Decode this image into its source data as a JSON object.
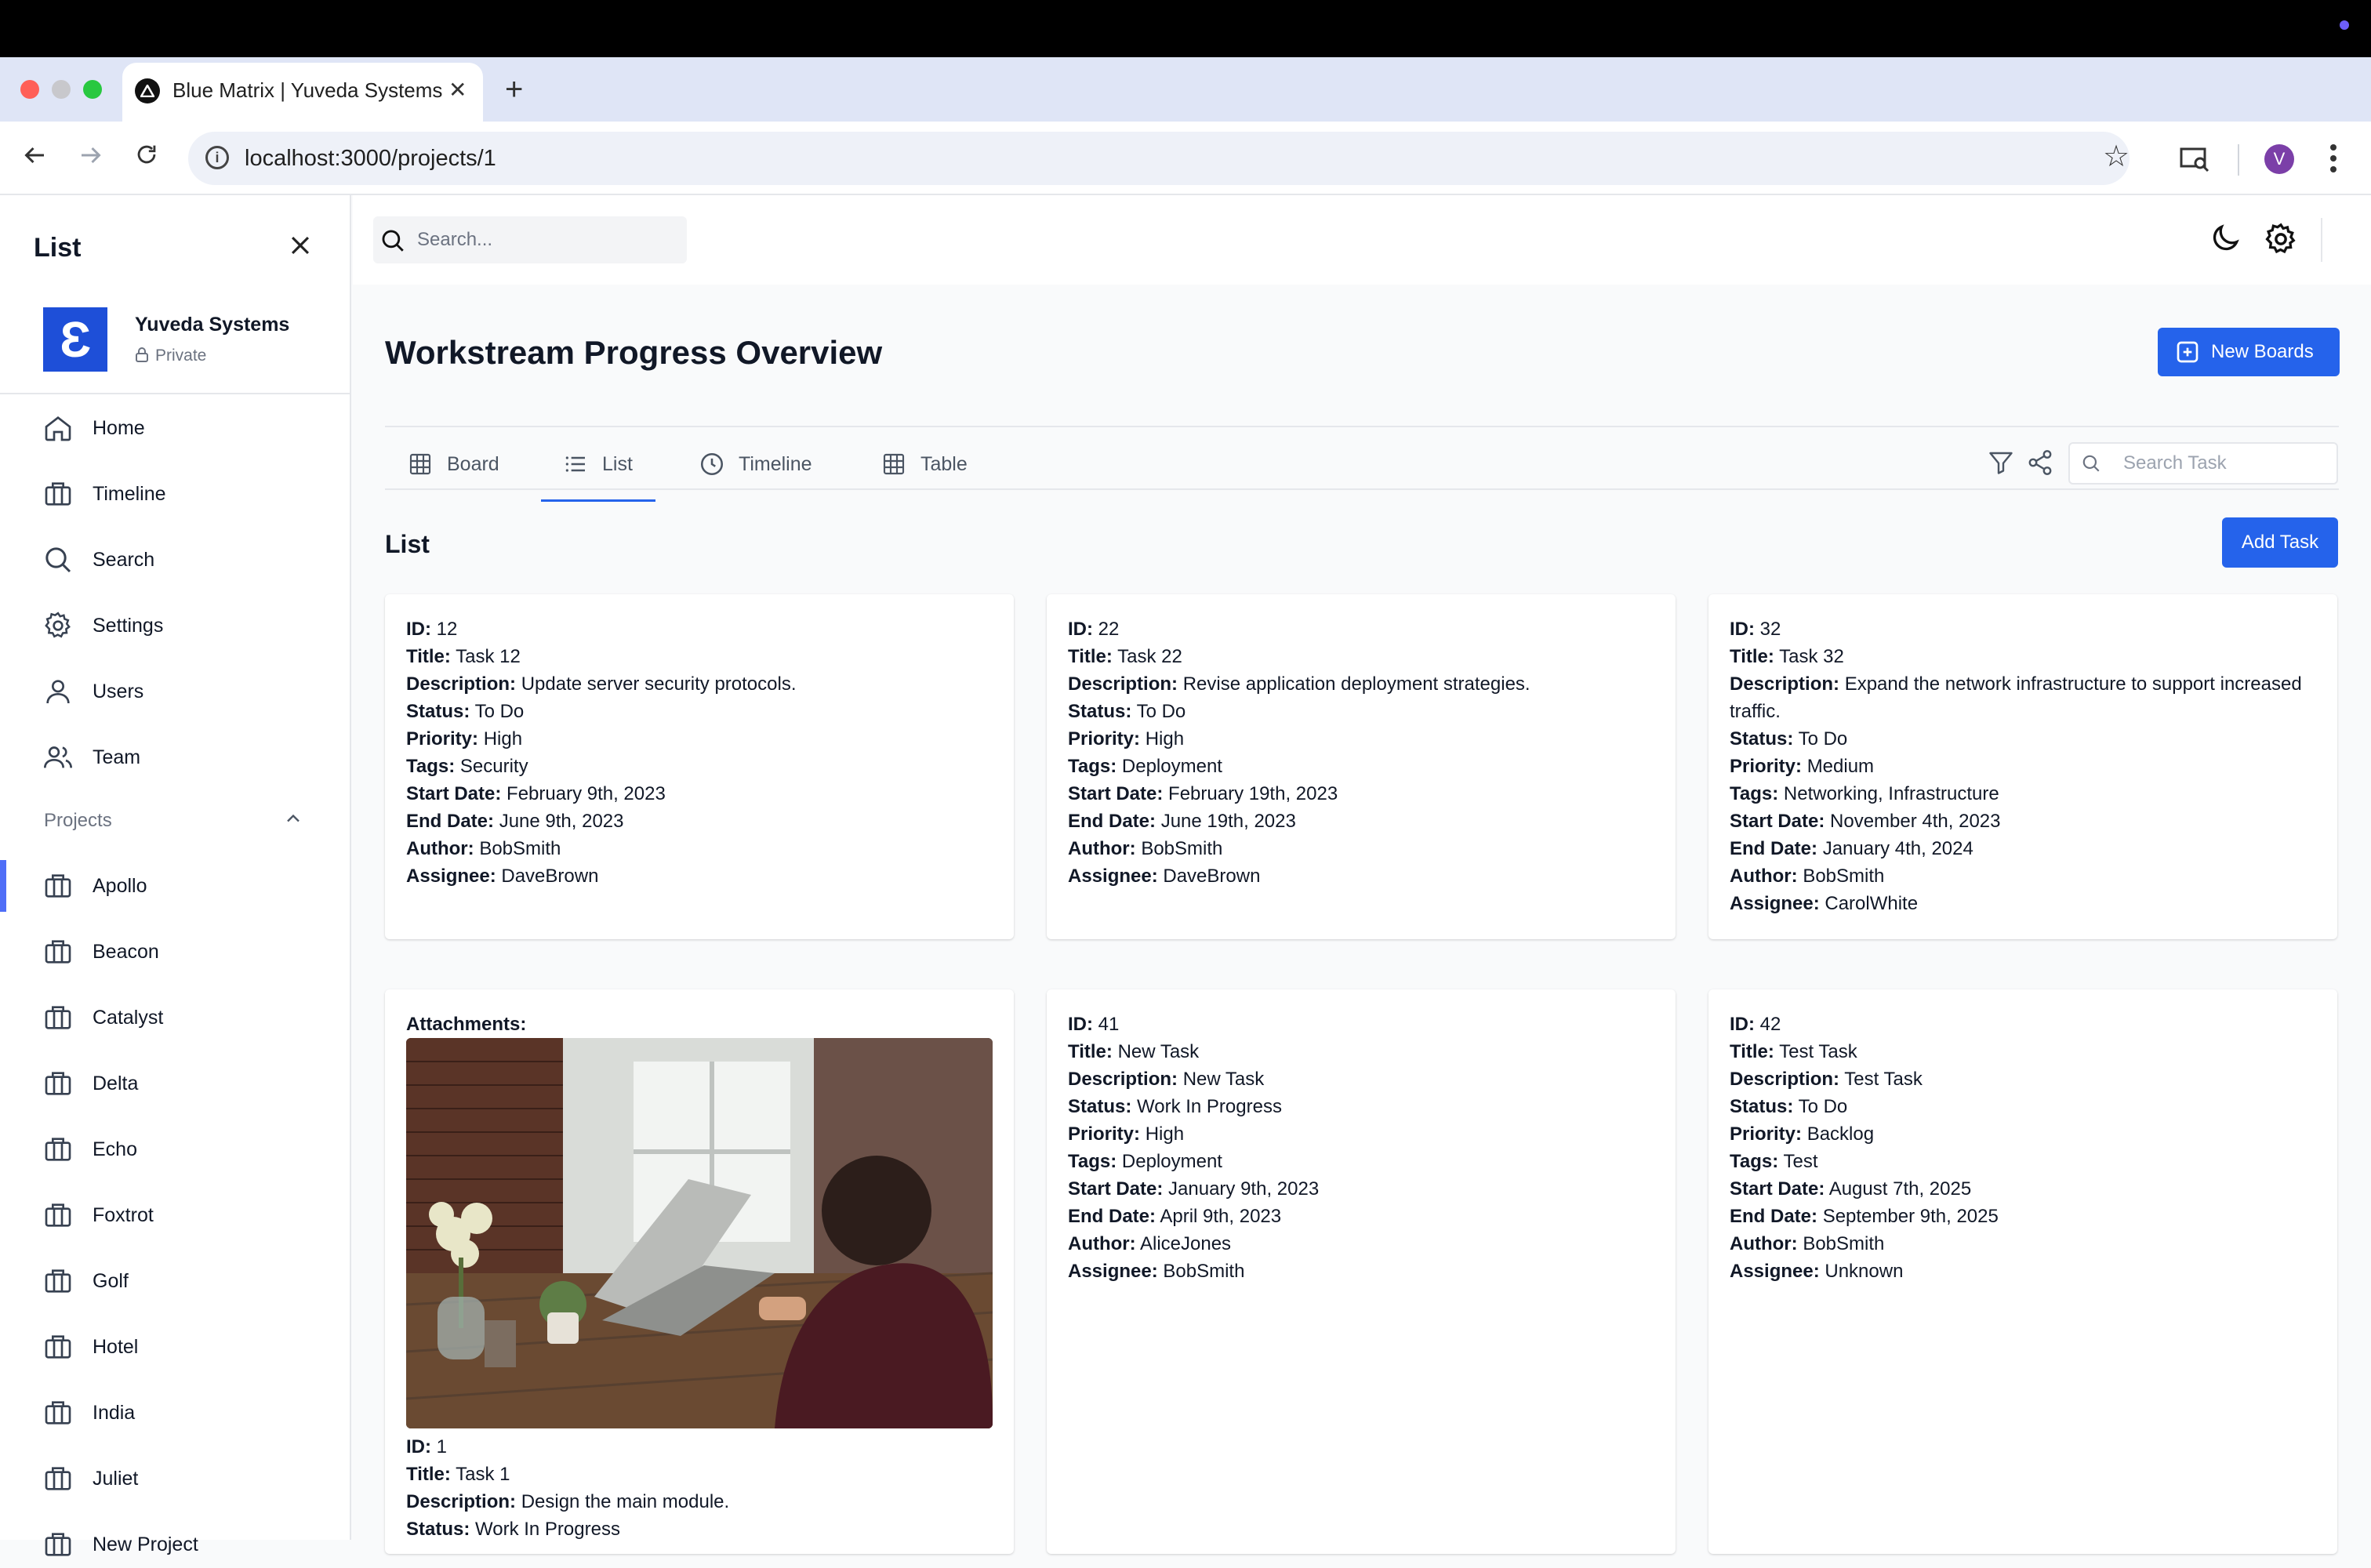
{
  "browser": {
    "tab_title": "Blue Matrix | Yuveda Systems",
    "tab_close": "✕",
    "new_tab": "+",
    "url": "localhost:3000/projects/1",
    "profile_initial": "V"
  },
  "sidebar": {
    "title": "List",
    "workspace": {
      "logo_letter": "Ɛ",
      "name": "Yuveda Systems",
      "privacy": "Private"
    },
    "nav": [
      {
        "label": "Home",
        "icon": "home-icon"
      },
      {
        "label": "Timeline",
        "icon": "briefcase-icon"
      },
      {
        "label": "Search",
        "icon": "search-icon"
      },
      {
        "label": "Settings",
        "icon": "gear-icon"
      },
      {
        "label": "Users",
        "icon": "user-icon"
      },
      {
        "label": "Team",
        "icon": "users-icon"
      }
    ],
    "projects_label": "Projects",
    "projects": [
      "Apollo",
      "Beacon",
      "Catalyst",
      "Delta",
      "Echo",
      "Foxtrot",
      "Golf",
      "Hotel",
      "India",
      "Juliet",
      "New Project"
    ],
    "active_project": "Apollo"
  },
  "header": {
    "search_placeholder": "Search..."
  },
  "main": {
    "title": "Workstream Progress Overview",
    "new_boards_label": "New Boards",
    "tabs": [
      {
        "label": "Board",
        "icon": "grid-icon"
      },
      {
        "label": "List",
        "icon": "list-icon"
      },
      {
        "label": "Timeline",
        "icon": "clock-icon"
      },
      {
        "label": "Table",
        "icon": "table-icon"
      }
    ],
    "active_tab": "List",
    "task_search_placeholder": "Search Task",
    "list_heading": "List",
    "add_task_label": "Add Task",
    "field_labels": {
      "id": "ID:",
      "title": "Title:",
      "description": "Description:",
      "status": "Status:",
      "priority": "Priority:",
      "tags": "Tags:",
      "start": "Start Date:",
      "end": "End Date:",
      "author": "Author:",
      "assignee": "Assignee:",
      "attachments": "Attachments:"
    },
    "tasks": [
      {
        "id": "12",
        "title": "Task 12",
        "description": "Update server security protocols.",
        "status": "To Do",
        "priority": "High",
        "tags": "Security",
        "start": "February 9th, 2023",
        "end": "June 9th, 2023",
        "author": "BobSmith",
        "assignee": "DaveBrown"
      },
      {
        "id": "22",
        "title": "Task 22",
        "description": "Revise application deployment strategies.",
        "status": "To Do",
        "priority": "High",
        "tags": "Deployment",
        "start": "February 19th, 2023",
        "end": "June 19th, 2023",
        "author": "BobSmith",
        "assignee": "DaveBrown"
      },
      {
        "id": "32",
        "title": "Task 32",
        "description": "Expand the network infrastructure to support increased traffic.",
        "status": "To Do",
        "priority": "Medium",
        "tags": "Networking, Infrastructure",
        "start": "November 4th, 2023",
        "end": "January 4th, 2024",
        "author": "BobSmith",
        "assignee": "CarolWhite"
      },
      {
        "id": "1",
        "title": "Task 1",
        "description": "Design the main module.",
        "status": "Work In Progress"
      },
      {
        "id": "41",
        "title": "New Task",
        "description": "New Task",
        "status": "Work In Progress",
        "priority": "High",
        "tags": "Deployment",
        "start": "January 9th, 2023",
        "end": "April 9th, 2023",
        "author": "AliceJones",
        "assignee": "BobSmith"
      },
      {
        "id": "42",
        "title": "Test Task",
        "description": "Test Task",
        "status": "To Do",
        "priority": "Backlog",
        "tags": "Test",
        "start": "August 7th, 2025",
        "end": "September 9th, 2025",
        "author": "BobSmith",
        "assignee": "Unknown"
      }
    ]
  },
  "colors": {
    "accent": "#2563eb",
    "logo": "#1e4fd8",
    "active_bar": "#4f6ef7"
  }
}
